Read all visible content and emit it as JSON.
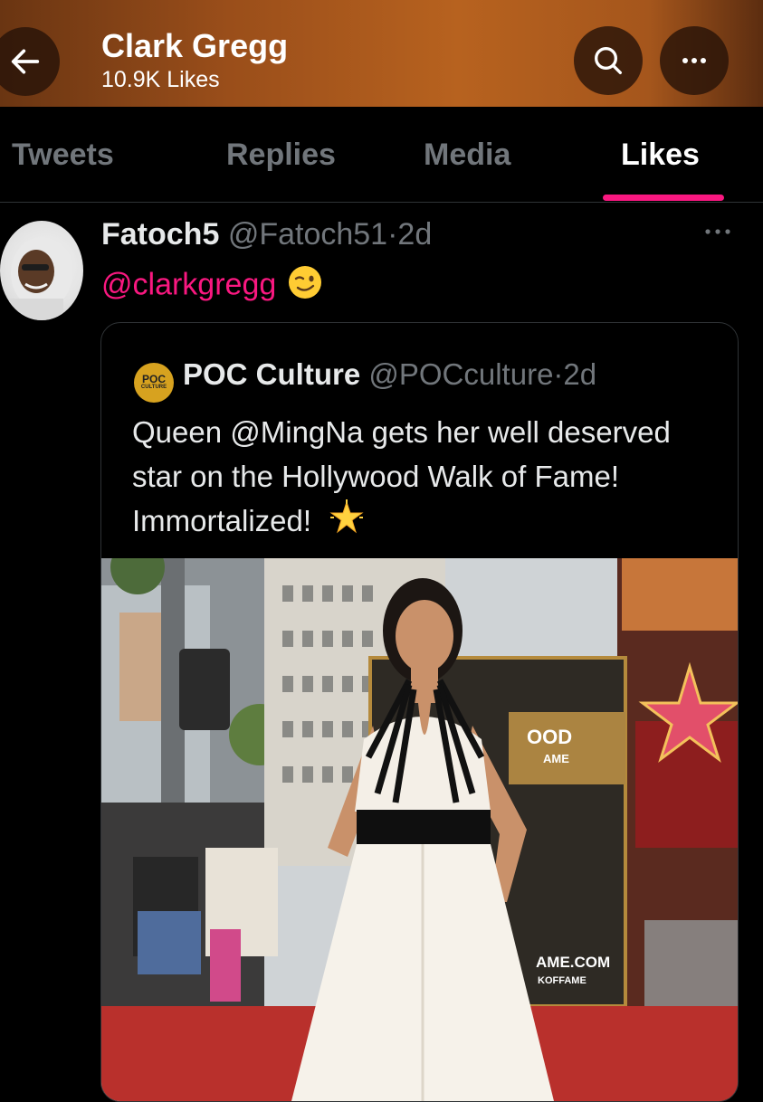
{
  "header": {
    "title": "Clark Gregg",
    "subtitle": "10.9K Likes"
  },
  "tabs": [
    {
      "label": "Tweets",
      "active": false
    },
    {
      "label": "Replies",
      "active": false
    },
    {
      "label": "Media",
      "active": false
    },
    {
      "label": "Likes",
      "active": true
    }
  ],
  "tweet": {
    "author_name": "Fatoch5",
    "author_handle": "@Fatoch51",
    "separator": "·",
    "time": "2d",
    "mention": "@clarkgregg",
    "emoji": "winking-face",
    "quote": {
      "logo_text": "POC",
      "logo_subtext": "CULTURE",
      "author_name": "POC Culture",
      "author_handle": "@POCculture",
      "separator": "·",
      "time": "2d",
      "text": "Queen @MingNa gets her well deserved star on the Hollywood Walk of Fame! Immortalized!",
      "emoji": "glowing-star",
      "photo": {
        "sign_lines": [
          "OOD",
          "AME"
        ],
        "banner_lines": [
          "AME.COM",
          "KOFFAME"
        ]
      }
    }
  },
  "colors": {
    "accent": "#f91880",
    "background": "#000000",
    "muted_text": "#71767b",
    "header_brown": "#a5561c"
  }
}
